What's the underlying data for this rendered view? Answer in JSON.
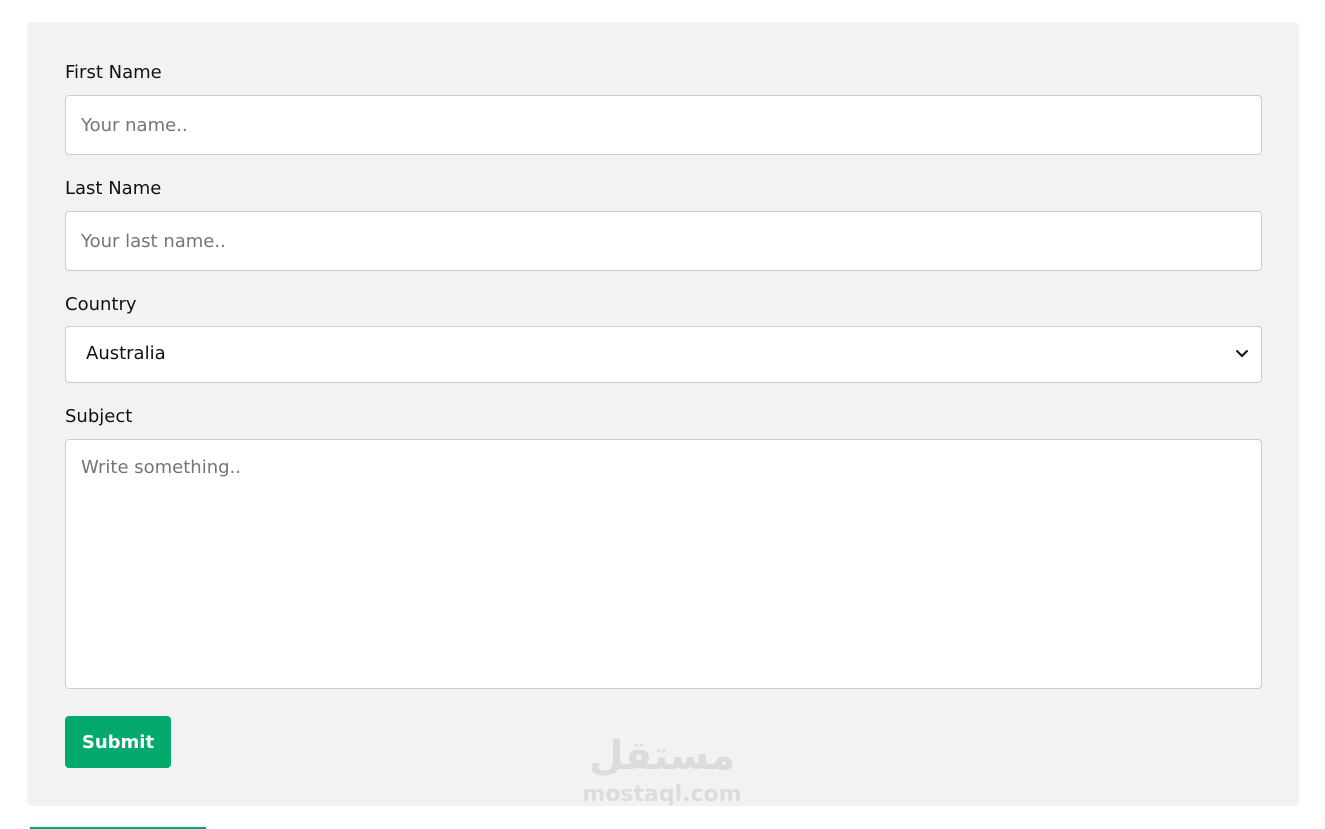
{
  "form": {
    "first_name": {
      "label": "First Name",
      "placeholder": "Your name.."
    },
    "last_name": {
      "label": "Last Name",
      "placeholder": "Your last name.."
    },
    "country": {
      "label": "Country",
      "selected": "Australia"
    },
    "subject": {
      "label": "Subject",
      "placeholder": "Write something.."
    },
    "submit_label": "Submit"
  },
  "watermark": {
    "logo_text": "مستقل",
    "url": "mostaql.com"
  },
  "colors": {
    "accent": "#04aa6d",
    "panel": "#f2f2f2",
    "border": "#cccccc"
  }
}
